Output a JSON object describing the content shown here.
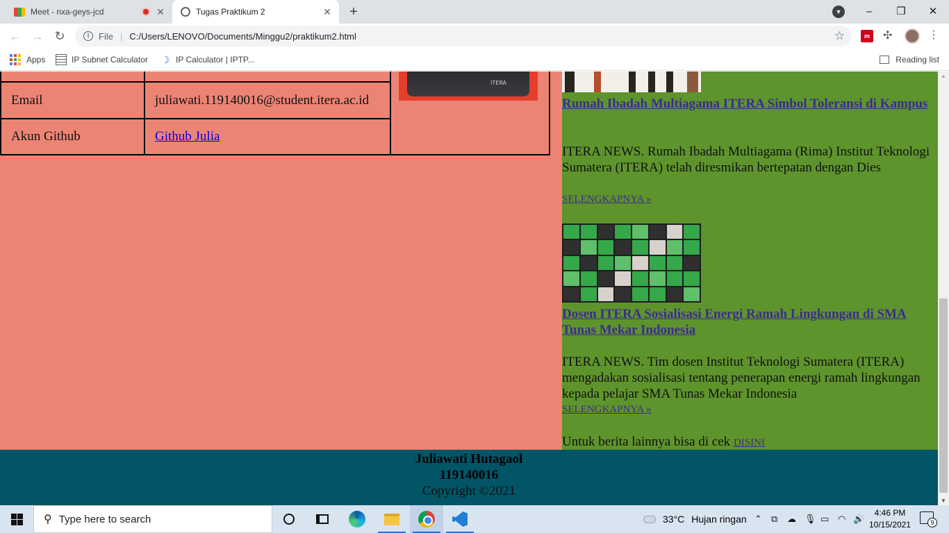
{
  "browser": {
    "tabs": [
      {
        "title": "Meet - nxa-geys-jcd",
        "active": false,
        "recording": true
      },
      {
        "title": "Tugas Praktikum 2",
        "active": true
      }
    ],
    "new_tab": "+",
    "window_controls": {
      "minimize": "–",
      "maximize": "❐",
      "close": "✕"
    },
    "address": {
      "scheme": "File",
      "url": "C:/Users/LENOVO/Documents/Minggu2/praktikum2.html"
    },
    "bookmarks": [
      {
        "label": "Apps",
        "icon": "apps-grid-icon"
      },
      {
        "label": "IP Subnet Calculator",
        "icon": "calculator-icon"
      },
      {
        "label": "IP Calculator | IPTP...",
        "icon": "moon-icon"
      }
    ],
    "reading_list": "Reading list"
  },
  "profile": {
    "rows": [
      {
        "label": "Email",
        "value": "juliawati.119140016@student.itera.ac.id",
        "is_link": false
      },
      {
        "label": "Akun Github",
        "value": "Github Julia",
        "is_link": true
      }
    ],
    "photo_logo": "ITERA"
  },
  "news": {
    "items": [
      {
        "title": "Rumah Ibadah Multiagama ITERA Simbol Toleransi di Kampus",
        "summary": "ITERA NEWS. Rumah Ibadah Multiagama (Rima) Institut Teknologi Sumatera (ITERA) telah diresmikan bertepatan dengan Dies",
        "more": "SELENGKAPNYA »"
      },
      {
        "title": "Dosen ITERA Sosialisasi Energi Ramah Lingkungan di SMA Tunas Mekar Indonesia",
        "summary": "ITERA NEWS. Tim dosen Institut Teknologi Sumatera (ITERA) mengadakan sosialisasi tentang penerapan energi ramah lingkungan kepada pelajar SMA Tunas Mekar Indonesia",
        "more": "SELENGKAPNYA »"
      }
    ],
    "footer_text": "Untuk berita lainnya bisa di cek",
    "footer_link": "DISINI"
  },
  "footer": {
    "name": "Juliawati Hutagaol",
    "nim": "119140016",
    "copyright": "Copyright ©2021"
  },
  "taskbar": {
    "search_placeholder": "Type here to search",
    "weather_temp": "33°C",
    "weather_desc": "Hujan ringan",
    "time": "4:46 PM",
    "date": "10/15/2021",
    "notification_count": "9"
  },
  "colors": {
    "left_panel": "#ec8474",
    "right_panel": "#5e942c",
    "footer": "#015566",
    "link": "#3d2b8f"
  }
}
